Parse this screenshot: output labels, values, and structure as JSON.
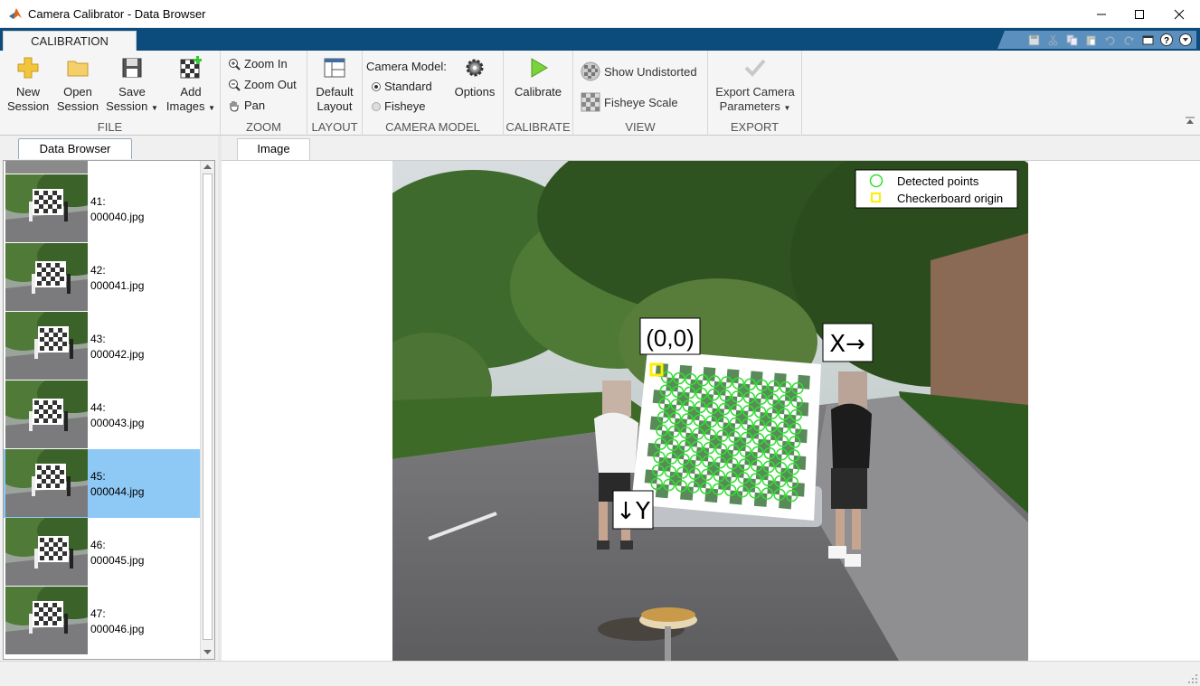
{
  "window": {
    "title": "Camera Calibrator - Data Browser"
  },
  "ribbon_tab": "CALIBRATION",
  "groups": {
    "file": {
      "label": "FILE",
      "new_session": [
        "New",
        "Session"
      ],
      "open_session": [
        "Open",
        "Session"
      ],
      "save_session": [
        "Save",
        "Session"
      ],
      "add_images": [
        "Add",
        "Images"
      ]
    },
    "zoom": {
      "label": "ZOOM",
      "zoom_in": "Zoom In",
      "zoom_out": "Zoom Out",
      "pan": "Pan"
    },
    "layout": {
      "label": "LAYOUT",
      "default_layout": [
        "Default",
        "Layout"
      ]
    },
    "camera_model": {
      "label": "CAMERA MODEL",
      "heading": "Camera Model:",
      "standard": "Standard",
      "fisheye": "Fisheye",
      "selected": "Standard",
      "options": "Options"
    },
    "calibrate": {
      "label": "CALIBRATE",
      "calibrate": "Calibrate"
    },
    "view": {
      "label": "VIEW",
      "show_undistorted": "Show Undistorted",
      "fisheye_scale": "Fisheye Scale"
    },
    "export": {
      "label": "EXPORT",
      "export_params": [
        "Export Camera",
        "Parameters"
      ]
    }
  },
  "data_browser": {
    "tab": "Data Browser",
    "items": [
      {
        "index": "41:",
        "file": "000040.jpg"
      },
      {
        "index": "42:",
        "file": "000041.jpg"
      },
      {
        "index": "43:",
        "file": "000042.jpg"
      },
      {
        "index": "44:",
        "file": "000043.jpg"
      },
      {
        "index": "45:",
        "file": "000044.jpg"
      },
      {
        "index": "46:",
        "file": "000045.jpg"
      },
      {
        "index": "47:",
        "file": "000046.jpg"
      }
    ],
    "selected_index": 4
  },
  "image_panel": {
    "tab": "Image",
    "legend": {
      "detected": "Detected points",
      "origin": "Checkerboard origin"
    },
    "annotations": {
      "origin": "(0,0)",
      "x_axis": "X→",
      "y_axis": "↓Y"
    }
  },
  "colors": {
    "title_bar_bg": "#ffffff",
    "ribbon_tab_strip": "#0c4c7c",
    "selection": "#8ec9f5",
    "detected_point": "#33dd33",
    "origin_marker": "#ffee00"
  }
}
